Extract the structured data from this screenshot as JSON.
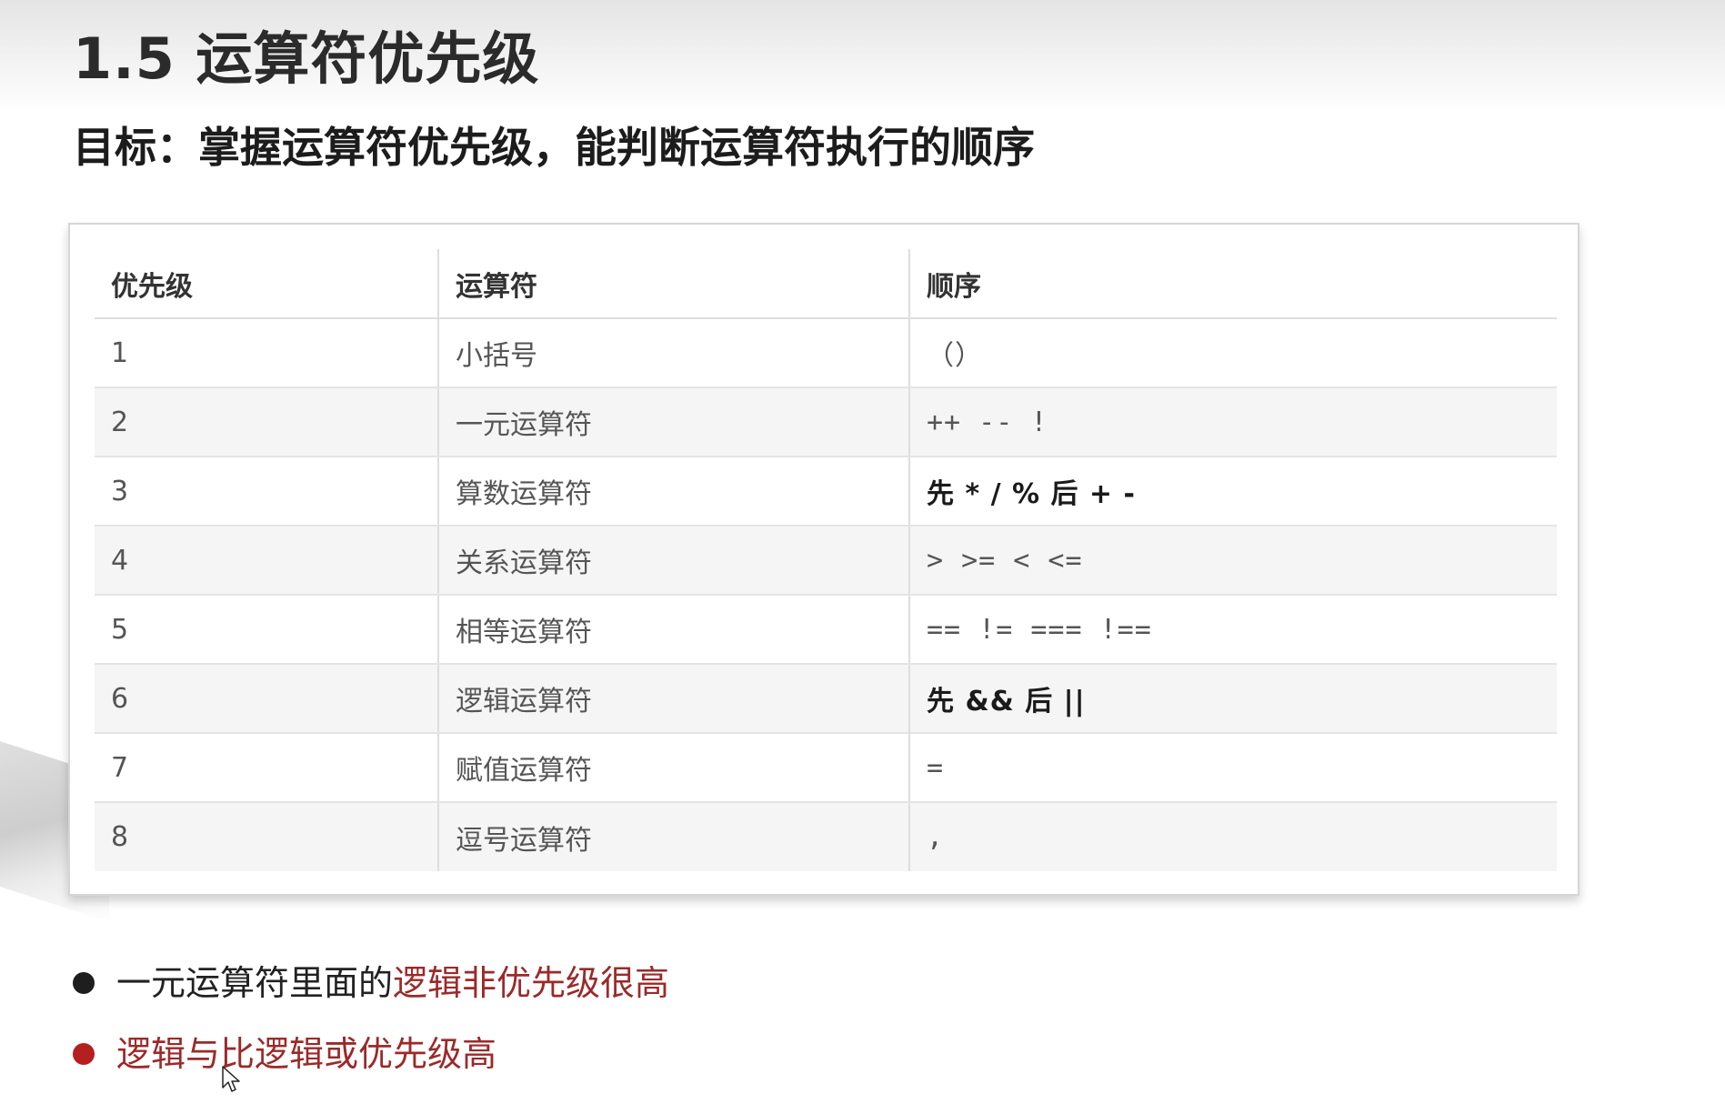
{
  "slide": {
    "title": "1.5 运算符优先级",
    "goal": "目标：掌握运算符优先级，能判断运算符执行的顺序"
  },
  "table": {
    "headers": [
      "优先级",
      "运算符",
      "顺序"
    ],
    "rows": [
      {
        "level": "1",
        "operator": "小括号",
        "order": "（）"
      },
      {
        "level": "2",
        "operator": "一元运算符",
        "order": "++  --  !"
      },
      {
        "level": "3",
        "operator": "算数运算符",
        "order": "先 * / % 后 + -"
      },
      {
        "level": "4",
        "operator": "关系运算符",
        "order": ">  >=  <  <="
      },
      {
        "level": "5",
        "operator": "相等运算符",
        "order": "==  !=  ===  !=="
      },
      {
        "level": "6",
        "operator": "逻辑运算符",
        "order": "先 &&  后 ||"
      },
      {
        "level": "7",
        "operator": "赋值运算符",
        "order": "="
      },
      {
        "level": "8",
        "operator": "逗号运算符",
        "order": ","
      }
    ]
  },
  "notes": [
    {
      "plain": "一元运算符里面的",
      "emphasis": "逻辑非优先级很高"
    },
    {
      "plain": "",
      "emphasis": "逻辑与比逻辑或优先级高"
    }
  ],
  "colors": {
    "emphasis": "#9b2a2a",
    "bullet_dark": "#1e1e1e",
    "bullet_red": "#b3201f"
  },
  "icons": {
    "cursor": "mouse-pointer-icon"
  }
}
